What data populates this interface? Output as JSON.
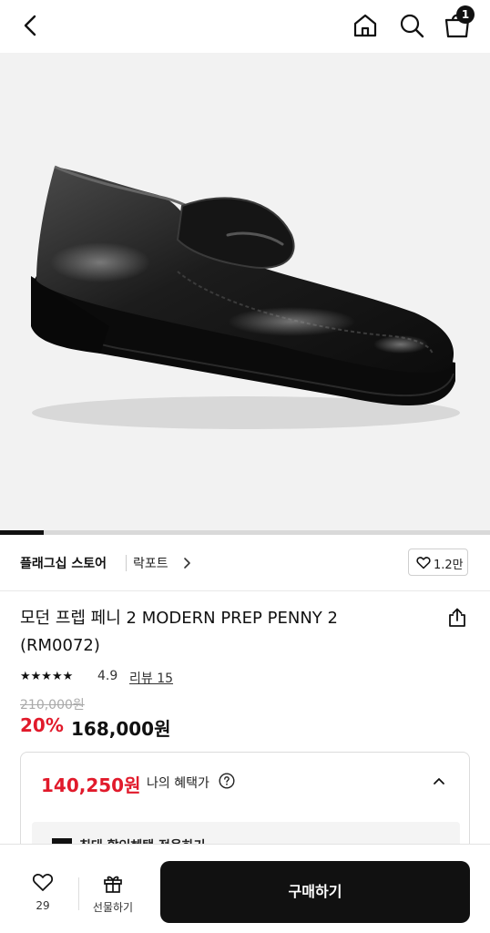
{
  "header": {
    "cart_count": "1",
    "icons": [
      "back-icon",
      "home-icon",
      "search-icon",
      "shopping-bag-icon"
    ]
  },
  "gallery": {
    "progress_fraction": 0.09,
    "image_subject": "black leather penny loafer"
  },
  "store": {
    "name": "플래그십 스토어",
    "brand": "락포트",
    "likes": "1.2만"
  },
  "product": {
    "title": "모던 프렙 페니 2 MODERN PREP PENNY 2 (RM0072)",
    "stars": "★★★★★",
    "rating": "4.9",
    "reviews": "리뷰 15",
    "original_price": "210,000원",
    "discount": "20%",
    "sale_price": "168,000원"
  },
  "benefit": {
    "price": "140,250원",
    "label": "나의 혜택가",
    "inner_text": "최대 할인혜택 적용하기"
  },
  "bottom": {
    "wish_count": "29",
    "gift_label": "선물하기",
    "buy_label": "구매하기"
  },
  "colors": {
    "accent_red": "#e11a2b",
    "primary_black": "#111111"
  }
}
